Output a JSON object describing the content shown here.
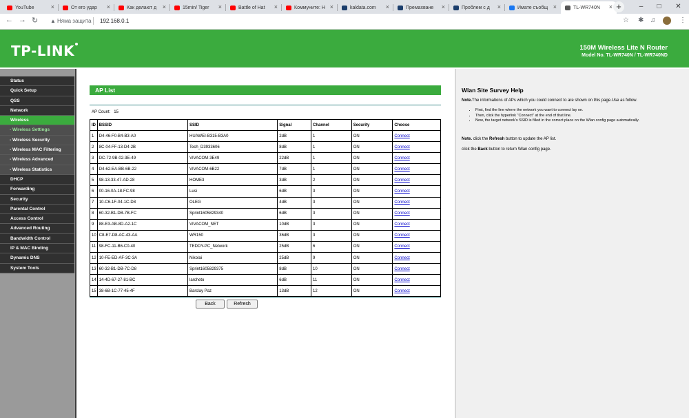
{
  "browser": {
    "tabs": [
      {
        "label": "YouTube",
        "favicon_color": "#ff0000"
      },
      {
        "label": "От его удар",
        "favicon_color": "#ff0000"
      },
      {
        "label": "Как делают д",
        "favicon_color": "#ff0000"
      },
      {
        "label": "15min/ Tiger",
        "favicon_color": "#ff0000"
      },
      {
        "label": "Battle of Hat",
        "favicon_color": "#ff0000"
      },
      {
        "label": "Коммуните: Н",
        "favicon_color": "#ff0000"
      },
      {
        "label": "kaldata.com",
        "favicon_color": "#1a3d6b"
      },
      {
        "label": "Премахване",
        "favicon_color": "#1a3d6b"
      },
      {
        "label": "Проблем с д",
        "favicon_color": "#1a3d6b"
      },
      {
        "label": "Имате съобщ",
        "favicon_color": "#1877f2"
      },
      {
        "label": "TL-WR740N",
        "favicon_color": "#555555"
      }
    ],
    "security_label": "Няма защита",
    "url": "192.168.0.1"
  },
  "router": {
    "logo": "TP-LINK",
    "model_title": "150M Wireless Lite N Router",
    "model_number": "Model No. TL-WR740N / TL-WR740ND",
    "brand_color": "#3bab3e"
  },
  "menu": [
    {
      "label": "Status",
      "type": "main"
    },
    {
      "label": "Quick Setup",
      "type": "main"
    },
    {
      "label": "QSS",
      "type": "main"
    },
    {
      "label": "Network",
      "type": "main"
    },
    {
      "label": "Wireless",
      "type": "active"
    },
    {
      "label": "- Wireless Settings",
      "type": "sub-active"
    },
    {
      "label": "- Wireless Security",
      "type": "sub"
    },
    {
      "label": "- Wireless MAC Filtering",
      "type": "sub"
    },
    {
      "label": "- Wireless Advanced",
      "type": "sub"
    },
    {
      "label": "- Wireless Statistics",
      "type": "sub"
    },
    {
      "label": "DHCP",
      "type": "main"
    },
    {
      "label": "Forwarding",
      "type": "main"
    },
    {
      "label": "Security",
      "type": "main"
    },
    {
      "label": "Parental Control",
      "type": "main"
    },
    {
      "label": "Access Control",
      "type": "main"
    },
    {
      "label": "Advanced Routing",
      "type": "main"
    },
    {
      "label": "Bandwidth Control",
      "type": "main"
    },
    {
      "label": "IP & MAC Binding",
      "type": "main"
    },
    {
      "label": "Dynamic DNS",
      "type": "main"
    },
    {
      "label": "System Tools",
      "type": "main"
    }
  ],
  "ap_list": {
    "title": "AP List",
    "count_label": "AP Count:",
    "count": "15",
    "columns": [
      "ID",
      "BSSID",
      "SSID",
      "Signal",
      "Channel",
      "Security",
      "Choose"
    ],
    "rows": [
      [
        "1",
        "D4-46-F0-B4-B3-A0",
        "HUAWEI-B315-B3A0",
        "2dB",
        "1",
        "ON",
        "Connect"
      ],
      [
        "2",
        "8C-04-FF-13-D4-2B",
        "Tech_D3933606",
        "8dB",
        "1",
        "ON",
        "Connect"
      ],
      [
        "3",
        "DC-72-9B-02-3E-49",
        "VIVACOM-3E49",
        "22dB",
        "1",
        "ON",
        "Connect"
      ],
      [
        "4",
        "D4-62-EA-BB-6B-22",
        "VIVACOM-6B22",
        "7dB",
        "1",
        "ON",
        "Connect"
      ],
      [
        "5",
        "98-13-33-47-AD-28",
        "HOME3",
        "3dB",
        "2",
        "ON",
        "Connect"
      ],
      [
        "6",
        "00-16-0A-18-FC-98",
        "Lusi",
        "6dB",
        "3",
        "ON",
        "Connect"
      ],
      [
        "7",
        "10-C6-1F-04-1C-D8",
        "OLEG",
        "4dB",
        "3",
        "ON",
        "Connect"
      ],
      [
        "8",
        "60-32-B1-DB-7B-FC",
        "Sprint1605829340",
        "6dB",
        "3",
        "ON",
        "Connect"
      ],
      [
        "9",
        "88-E3-AB-8D-A2-1C",
        "VIVACOM_NET",
        "10dB",
        "3",
        "ON",
        "Connect"
      ],
      [
        "10",
        "C8-E7-D8-AC-43-AA",
        "WR150",
        "36dB",
        "3",
        "ON",
        "Connect"
      ],
      [
        "11",
        "98-FC-11-B6-C0-40",
        "TEDDY-PC_Network",
        "25dB",
        "6",
        "ON",
        "Connect"
      ],
      [
        "12",
        "10-FE-ED-AF-3C-3A",
        "Nikolai",
        "25dB",
        "9",
        "ON",
        "Connect"
      ],
      [
        "13",
        "60-32-B1-DB-7C-D8",
        "Sprint1605829375",
        "8dB",
        "10",
        "ON",
        "Connect"
      ],
      [
        "14",
        "14-4D-67-27-81-BC",
        "larcheto",
        "6dB",
        "11",
        "ON",
        "Connect"
      ],
      [
        "15",
        "38-6B-1C-77-45-4F",
        "Barclay Paz",
        "13dB",
        "12",
        "ON",
        "Connect"
      ]
    ],
    "back_label": "Back",
    "refresh_label": "Refresh"
  },
  "help": {
    "title": "Wlan Site Survey Help",
    "note1_label": "Note.",
    "note1_text": "The informations of APs which you could connect to are shown on this page.Use as follow.",
    "steps": [
      "First, find the line where the network you want to connect lay on.",
      "Then, click the hyperlink \"Connect\" at the end of that line.",
      "Now, the target network's SSID is filled in the correct place on the Wlan config page automatically."
    ],
    "note2_label": "Note.",
    "note2_text_a": " click the ",
    "note2_refresh": "Refresh",
    "note2_text_b": " button to update the AP list.",
    "back_text_a": "click the ",
    "back_bold": "Back",
    "back_text_b": " button to return Wlan config page."
  }
}
